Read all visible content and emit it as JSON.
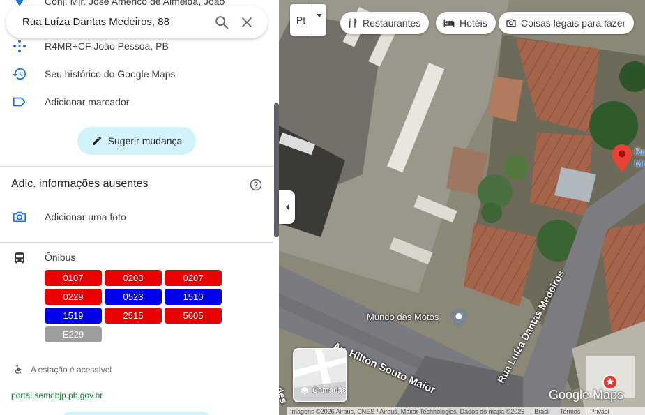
{
  "search": {
    "value": "Rua Luíza Dantas Medeiros, 88",
    "search_icon": "search-icon",
    "close_icon": "close-icon"
  },
  "panel": {
    "partial_address": "Conj. Mjr. Jose Americo de Almeida, João",
    "plus_code": "R4MR+CF João Pessoa, PB",
    "history": "Seu histórico do Google Maps",
    "add_label": "Adicionar marcador",
    "suggest_edit": "Sugerir mudança",
    "missing_info_title": "Adic. informações ausentes",
    "add_photo": "Adicionar uma foto",
    "bus_title": "Ônibus",
    "bus_routes": [
      {
        "code": "0107",
        "color": "#ea0000"
      },
      {
        "code": "0203",
        "color": "#ea0000"
      },
      {
        "code": "0207",
        "color": "#ea0000"
      },
      {
        "code": "0229",
        "color": "#ea0000"
      },
      {
        "code": "0523",
        "color": "#0000ea"
      },
      {
        "code": "1510",
        "color": "#0000ea"
      },
      {
        "code": "1519",
        "color": "#0000ea"
      },
      {
        "code": "2515",
        "color": "#ea0000"
      },
      {
        "code": "5605",
        "color": "#ea0000"
      },
      {
        "code": "E229",
        "color": "#9e9e9e"
      }
    ],
    "accessible": "A estação é acessível",
    "portal": "portal.semobjp.pb.gov.br"
  },
  "map": {
    "transit_label": "Pt",
    "chips": [
      {
        "label": "Restaurantes",
        "icon": "fork-knife-icon"
      },
      {
        "label": "Hotéis",
        "icon": "bed-icon"
      },
      {
        "label": "Coisas legais para fazer",
        "icon": "camera-icon"
      }
    ],
    "pin_label_1": "Ru",
    "pin_label_2": "Me",
    "place_mundo": "Mundo das Motos",
    "street_hilton": "Av. Hilton Souto Maior",
    "street_luiza": "Rua Luíza Dantas Medeiros",
    "street_partial": "des",
    "layers_label": "Camadas",
    "logo": "Google Maps",
    "attribution": "Imagens ©2026 Airbus, CNES / Airbus, Maxar Technologies, Dados do mapa ©2026",
    "brasil": "Brasil",
    "termos": "Termos",
    "privacidade": "Privaci",
    "colors": {
      "pin": "#ea4335",
      "chip_bg": "#ffffff",
      "accent": "#1a73e8"
    }
  }
}
